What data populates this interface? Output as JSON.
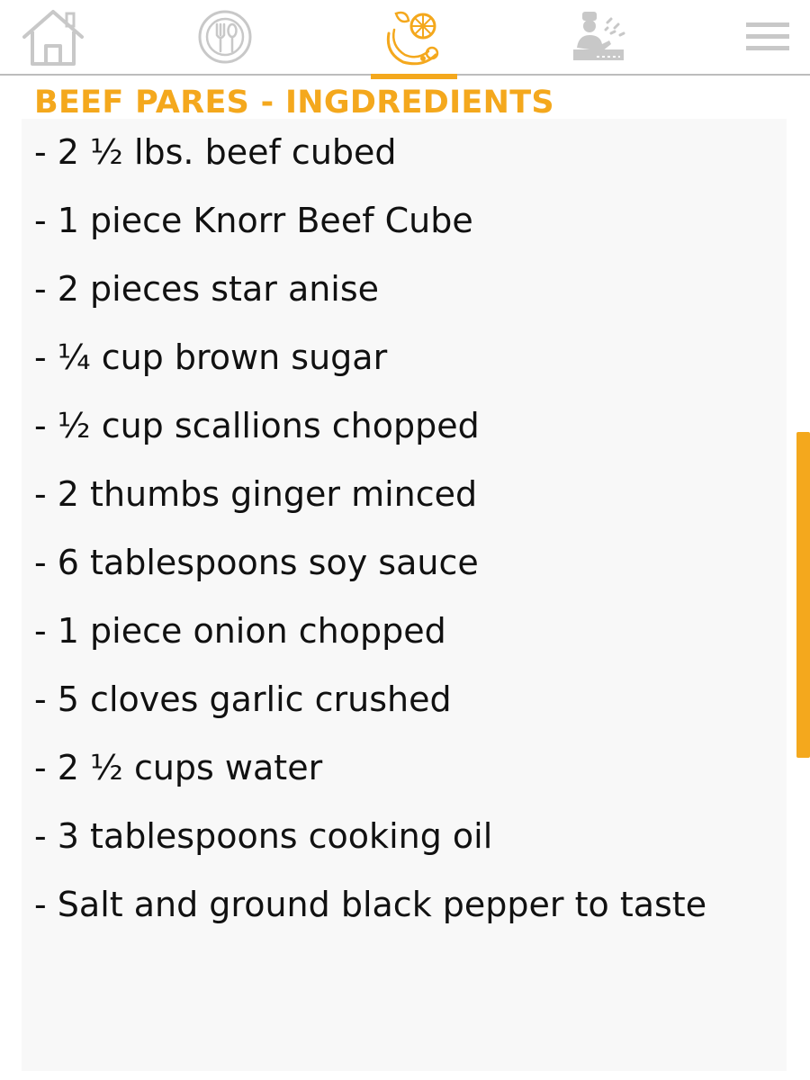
{
  "title": "BEEF PARES - INGDREDIENTS",
  "nav": {
    "items": [
      {
        "icon": "home-icon",
        "active": false
      },
      {
        "icon": "plate-cutlery-icon",
        "active": false
      },
      {
        "icon": "ingredients-icon",
        "active": true
      },
      {
        "icon": "chef-cooking-icon",
        "active": false
      },
      {
        "icon": "hamburger-menu-icon",
        "active": false
      }
    ]
  },
  "ingredients": [
    "- 2 ½ lbs. beef cubed",
    "- 1 piece Knorr Beef Cube",
    "- 2 pieces star anise",
    "- ¼ cup brown sugar",
    "- ½ cup scallions chopped",
    "- 2 thumbs ginger minced",
    "- 6 tablespoons soy sauce",
    "- 1 piece onion chopped",
    "- 5 cloves garlic crushed",
    "- 2 ½ cups water",
    "- 3 tablespoons cooking oil",
    "- Salt and ground black pepper to taste"
  ],
  "colors": {
    "accent": "#f4a81d",
    "icon_gray": "#bdbdbd",
    "text": "#111111",
    "panel": "#f8f8f8"
  }
}
